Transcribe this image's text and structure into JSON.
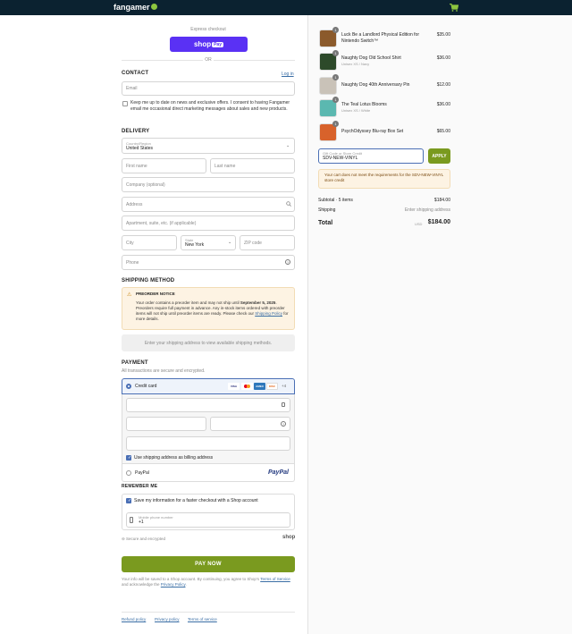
{
  "brand": {
    "name": "fangamer"
  },
  "express": {
    "label": "Express checkout",
    "shop_pay": "shop",
    "shop_pay_badge": "Pay",
    "or": "OR"
  },
  "contact": {
    "title": "CONTACT",
    "login": "Log in",
    "email_placeholder": "Email",
    "newsletter": "Keep me up to date on news and exclusive offers. I consent to having Fangamer email me occasional direct marketing messages about sales and new products."
  },
  "delivery": {
    "title": "DELIVERY",
    "country_label": "Country/Region",
    "country_value": "United States",
    "first_name": "First name",
    "last_name": "Last name",
    "company": "Company (optional)",
    "address": "Address",
    "apartment": "Apartment, suite, etc. (if applicable)",
    "city": "City",
    "state_label": "State",
    "state_value": "New York",
    "zip": "ZIP code",
    "phone": "Phone"
  },
  "shipping": {
    "title": "SHIPPING METHOD",
    "notice_title": "PREORDER NOTICE",
    "notice_part1": "Your order contains a preorder item and may not ship until ",
    "notice_date": "September 5, 2025",
    "notice_part2": ". Preorders require full payment in advance. Any in-stock items ordered with preorder items will not ship until preorder items are ready. Please check our ",
    "notice_link": "Shipping Policy",
    "notice_part3": " for more details.",
    "placeholder": "Enter your shipping address to view available shipping methods."
  },
  "payment": {
    "title": "PAYMENT",
    "subtitle": "All transactions are secure and encrypted.",
    "credit_card": "Credit card",
    "cards": [
      "VISA",
      "MC",
      "AMEX",
      "DISC"
    ],
    "more_cards": "+4",
    "billing_same": "Use shipping address as billing address",
    "paypal": "PayPal",
    "paypal_logo": "PayPal"
  },
  "remember": {
    "title": "REMEMBER ME",
    "save_info": "Save my information for a faster checkout with a Shop account",
    "phone_label": "Mobile phone number",
    "phone_value": "+1",
    "secure": "Secure and encrypted",
    "shop_logo": "shop"
  },
  "pay_now": "PAY NOW",
  "legal": {
    "part1": "Your info will be saved to a Shop account. By continuing, you agree to Shop's ",
    "terms": "Terms of Service",
    "part2": " and acknowledge the ",
    "privacy": "Privacy Policy",
    "part3": "."
  },
  "footer_links": [
    "Refund policy",
    "Privacy policy",
    "Terms of service"
  ],
  "cart": {
    "items": [
      {
        "qty": "1",
        "title": "Luck Be a Landlord Physical Edition for Nintendo Switch™",
        "sub": "",
        "price": "$35.00",
        "color": "#8b5a2b"
      },
      {
        "qty": "1",
        "title": "Naughty Dog Old School Shirt",
        "sub": "Unisex XS / Navy",
        "price": "$36.00",
        "color": "#2d4a2a"
      },
      {
        "qty": "1",
        "title": "Naughty Dog 40th Anniversary Pin",
        "sub": "",
        "price": "$12.00",
        "color": "#c9c2b8"
      },
      {
        "qty": "1",
        "title": "The Teal Lotus Blooms",
        "sub": "Unisex XS / White",
        "price": "$36.00",
        "color": "#5bb8b0"
      },
      {
        "qty": "1",
        "title": "PsychOdyssey Blu-ray Box Set",
        "sub": "",
        "price": "$65.00",
        "color": "#d8622b"
      }
    ],
    "gift_label": "Gift Code or Store Credit",
    "gift_value": "SDV-NEW-VINYL",
    "apply": "APPLY",
    "error": "Your cart does not meet the requirements for the SDV-NEW-VINYL store credit",
    "subtotal_label": "Subtotal · 5 items",
    "subtotal_value": "$184.00",
    "shipping_label": "Shipping",
    "shipping_value": "Enter shipping address",
    "total_label": "Total",
    "currency": "USD",
    "total_value": "$184.00"
  },
  "colors": {
    "accent": "#7a9a1f",
    "shop_pay": "#5a31f4",
    "topbar": "#0b2230",
    "brand_green": "#8dc63f"
  }
}
